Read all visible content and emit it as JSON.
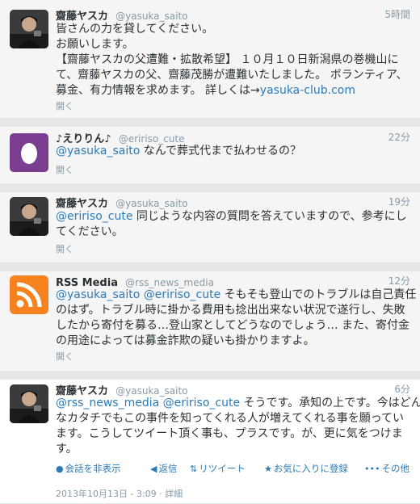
{
  "tweets": [
    {
      "fullname": "齋藤ヤスカ",
      "username": "@yasuka_saito",
      "time": "5時間",
      "lines": [
        {
          "text": "皆さんの力を貸してください。"
        },
        {
          "text": "お願いします。"
        },
        {
          "text": "【齋藤ヤスカの父遭難・拡散希望】 １０月１０日新潟県の巻機山に"
        },
        {
          "text": "て、齋藤ヤスカの父、齋藤茂勝が遭難いたしました。 ボランティア、"
        },
        {
          "pre": "募金、有力情報を求めます。 詳しくは→",
          "link": "yasuka-club.com"
        }
      ],
      "open": "開く"
    },
    {
      "fullname": "♪えりりん♪",
      "username": "@eririso_cute",
      "time": "22分",
      "lines": [
        {
          "link": "@yasuka_saito",
          "post": " なんで葬式代まで払わせるの？"
        }
      ],
      "open": "開く"
    },
    {
      "fullname": "齋藤ヤスカ",
      "username": "@yasuka_saito",
      "time": "19分",
      "lines": [
        {
          "link": "@eririso_cute",
          "post": " 同じような内容の質問を答えていますので、参考にし"
        },
        {
          "text": "てください。"
        }
      ],
      "open": "開く"
    },
    {
      "fullname": "RSS Media",
      "username": "@rss_news_media",
      "time": "12分",
      "lines": [
        {
          "link": "@yasuka_saito @eririso_cute",
          "post": " そもそも登山でのトラブルは自己責任"
        },
        {
          "text": "のはず。トラブル時に掛かる費用も捻出出来ない状況で遂行し、失敗"
        },
        {
          "text": "したから寄付を募る…登山家としてどうなのでしょう… また、寄付金"
        },
        {
          "text": "の用途によっては募金詐欺の疑いも掛かりますよ。"
        }
      ],
      "open": "開く"
    },
    {
      "fullname": "齋藤ヤスカ",
      "username": "@yasuka_saito",
      "time": "6分",
      "lines": [
        {
          "link": "@rss_news_media @eririso_cute",
          "post": " そうです。承知の上です。今はどん"
        },
        {
          "text": "なカタチでもこの事件を知ってくれる人が増えてくれる事を願ってい"
        },
        {
          "text": "ます。こうしてツイート頂く事も、プラスです。が、更に気をつけま"
        },
        {
          "text": "す。"
        }
      ]
    }
  ],
  "actions": {
    "hide": "会話を非表示",
    "reply": "返信",
    "retweet": "リツイート",
    "favorite": "お気に入りに登録",
    "more": "その他"
  },
  "footer": {
    "timestamp": "2013年10月13日 - 3:09 ·",
    "details": "詳細"
  },
  "icons": {
    "hide": "speech-bubble-icon",
    "reply": "reply-arrow-icon",
    "retweet": "retweet-icon",
    "favorite": "star-icon",
    "more": "more-dots-icon"
  },
  "colors": {
    "link": "#2b7bb9",
    "meta": "#8899a6",
    "rss": "#f5821f",
    "egg_bg": "#7a3d8f"
  }
}
